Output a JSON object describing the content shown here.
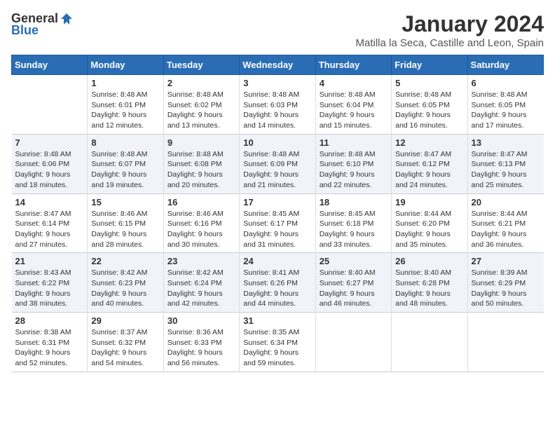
{
  "header": {
    "logo_general": "General",
    "logo_blue": "Blue",
    "month_title": "January 2024",
    "location": "Matilla la Seca, Castille and Leon, Spain"
  },
  "columns": [
    "Sunday",
    "Monday",
    "Tuesday",
    "Wednesday",
    "Thursday",
    "Friday",
    "Saturday"
  ],
  "weeks": [
    [
      {
        "num": "",
        "sunrise": "",
        "sunset": "",
        "daylight": ""
      },
      {
        "num": "1",
        "sunrise": "Sunrise: 8:48 AM",
        "sunset": "Sunset: 6:01 PM",
        "daylight": "Daylight: 9 hours and 12 minutes."
      },
      {
        "num": "2",
        "sunrise": "Sunrise: 8:48 AM",
        "sunset": "Sunset: 6:02 PM",
        "daylight": "Daylight: 9 hours and 13 minutes."
      },
      {
        "num": "3",
        "sunrise": "Sunrise: 8:48 AM",
        "sunset": "Sunset: 6:03 PM",
        "daylight": "Daylight: 9 hours and 14 minutes."
      },
      {
        "num": "4",
        "sunrise": "Sunrise: 8:48 AM",
        "sunset": "Sunset: 6:04 PM",
        "daylight": "Daylight: 9 hours and 15 minutes."
      },
      {
        "num": "5",
        "sunrise": "Sunrise: 8:48 AM",
        "sunset": "Sunset: 6:05 PM",
        "daylight": "Daylight: 9 hours and 16 minutes."
      },
      {
        "num": "6",
        "sunrise": "Sunrise: 8:48 AM",
        "sunset": "Sunset: 6:05 PM",
        "daylight": "Daylight: 9 hours and 17 minutes."
      }
    ],
    [
      {
        "num": "7",
        "sunrise": "Sunrise: 8:48 AM",
        "sunset": "Sunset: 6:06 PM",
        "daylight": "Daylight: 9 hours and 18 minutes."
      },
      {
        "num": "8",
        "sunrise": "Sunrise: 8:48 AM",
        "sunset": "Sunset: 6:07 PM",
        "daylight": "Daylight: 9 hours and 19 minutes."
      },
      {
        "num": "9",
        "sunrise": "Sunrise: 8:48 AM",
        "sunset": "Sunset: 6:08 PM",
        "daylight": "Daylight: 9 hours and 20 minutes."
      },
      {
        "num": "10",
        "sunrise": "Sunrise: 8:48 AM",
        "sunset": "Sunset: 6:09 PM",
        "daylight": "Daylight: 9 hours and 21 minutes."
      },
      {
        "num": "11",
        "sunrise": "Sunrise: 8:48 AM",
        "sunset": "Sunset: 6:10 PM",
        "daylight": "Daylight: 9 hours and 22 minutes."
      },
      {
        "num": "12",
        "sunrise": "Sunrise: 8:47 AM",
        "sunset": "Sunset: 6:12 PM",
        "daylight": "Daylight: 9 hours and 24 minutes."
      },
      {
        "num": "13",
        "sunrise": "Sunrise: 8:47 AM",
        "sunset": "Sunset: 6:13 PM",
        "daylight": "Daylight: 9 hours and 25 minutes."
      }
    ],
    [
      {
        "num": "14",
        "sunrise": "Sunrise: 8:47 AM",
        "sunset": "Sunset: 6:14 PM",
        "daylight": "Daylight: 9 hours and 27 minutes."
      },
      {
        "num": "15",
        "sunrise": "Sunrise: 8:46 AM",
        "sunset": "Sunset: 6:15 PM",
        "daylight": "Daylight: 9 hours and 28 minutes."
      },
      {
        "num": "16",
        "sunrise": "Sunrise: 8:46 AM",
        "sunset": "Sunset: 6:16 PM",
        "daylight": "Daylight: 9 hours and 30 minutes."
      },
      {
        "num": "17",
        "sunrise": "Sunrise: 8:45 AM",
        "sunset": "Sunset: 6:17 PM",
        "daylight": "Daylight: 9 hours and 31 minutes."
      },
      {
        "num": "18",
        "sunrise": "Sunrise: 8:45 AM",
        "sunset": "Sunset: 6:18 PM",
        "daylight": "Daylight: 9 hours and 33 minutes."
      },
      {
        "num": "19",
        "sunrise": "Sunrise: 8:44 AM",
        "sunset": "Sunset: 6:20 PM",
        "daylight": "Daylight: 9 hours and 35 minutes."
      },
      {
        "num": "20",
        "sunrise": "Sunrise: 8:44 AM",
        "sunset": "Sunset: 6:21 PM",
        "daylight": "Daylight: 9 hours and 36 minutes."
      }
    ],
    [
      {
        "num": "21",
        "sunrise": "Sunrise: 8:43 AM",
        "sunset": "Sunset: 6:22 PM",
        "daylight": "Daylight: 9 hours and 38 minutes."
      },
      {
        "num": "22",
        "sunrise": "Sunrise: 8:42 AM",
        "sunset": "Sunset: 6:23 PM",
        "daylight": "Daylight: 9 hours and 40 minutes."
      },
      {
        "num": "23",
        "sunrise": "Sunrise: 8:42 AM",
        "sunset": "Sunset: 6:24 PM",
        "daylight": "Daylight: 9 hours and 42 minutes."
      },
      {
        "num": "24",
        "sunrise": "Sunrise: 8:41 AM",
        "sunset": "Sunset: 6:26 PM",
        "daylight": "Daylight: 9 hours and 44 minutes."
      },
      {
        "num": "25",
        "sunrise": "Sunrise: 8:40 AM",
        "sunset": "Sunset: 6:27 PM",
        "daylight": "Daylight: 9 hours and 46 minutes."
      },
      {
        "num": "26",
        "sunrise": "Sunrise: 8:40 AM",
        "sunset": "Sunset: 6:28 PM",
        "daylight": "Daylight: 9 hours and 48 minutes."
      },
      {
        "num": "27",
        "sunrise": "Sunrise: 8:39 AM",
        "sunset": "Sunset: 6:29 PM",
        "daylight": "Daylight: 9 hours and 50 minutes."
      }
    ],
    [
      {
        "num": "28",
        "sunrise": "Sunrise: 8:38 AM",
        "sunset": "Sunset: 6:31 PM",
        "daylight": "Daylight: 9 hours and 52 minutes."
      },
      {
        "num": "29",
        "sunrise": "Sunrise: 8:37 AM",
        "sunset": "Sunset: 6:32 PM",
        "daylight": "Daylight: 9 hours and 54 minutes."
      },
      {
        "num": "30",
        "sunrise": "Sunrise: 8:36 AM",
        "sunset": "Sunset: 6:33 PM",
        "daylight": "Daylight: 9 hours and 56 minutes."
      },
      {
        "num": "31",
        "sunrise": "Sunrise: 8:35 AM",
        "sunset": "Sunset: 6:34 PM",
        "daylight": "Daylight: 9 hours and 59 minutes."
      },
      {
        "num": "",
        "sunrise": "",
        "sunset": "",
        "daylight": ""
      },
      {
        "num": "",
        "sunrise": "",
        "sunset": "",
        "daylight": ""
      },
      {
        "num": "",
        "sunrise": "",
        "sunset": "",
        "daylight": ""
      }
    ]
  ]
}
